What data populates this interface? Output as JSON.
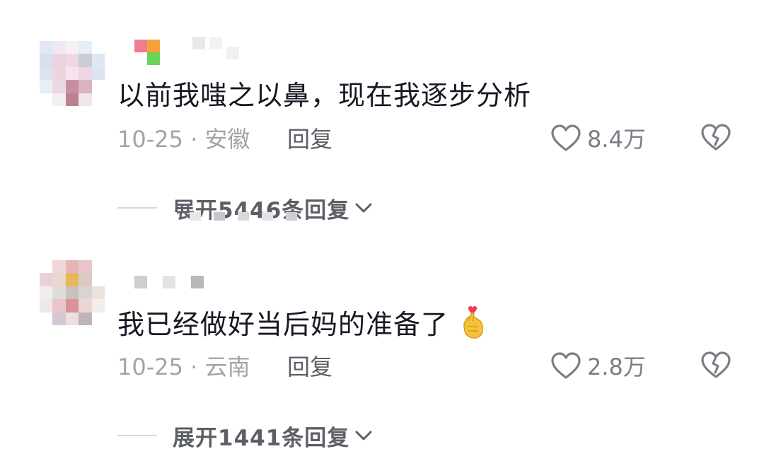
{
  "comments": [
    {
      "text": "以前我嗤之以鼻，现在我逐步分析",
      "time_location": "10-25 · 安徽",
      "reply_label": "回复",
      "like_count": "8.4万",
      "expand_label": "展开5446条回复"
    },
    {
      "text": "我已经做好当后妈的准备了",
      "emoji": "finger-heart-emoji",
      "time_location": "10-25 · 云南",
      "reply_label": "回复",
      "like_count": "2.8万",
      "expand_label": "展开1441条回复"
    }
  ],
  "colors": {
    "primary_text": "#161823",
    "secondary_text": "#a2a4a9",
    "action_text": "#5c5f66",
    "icon_stroke": "#7b7e86"
  }
}
